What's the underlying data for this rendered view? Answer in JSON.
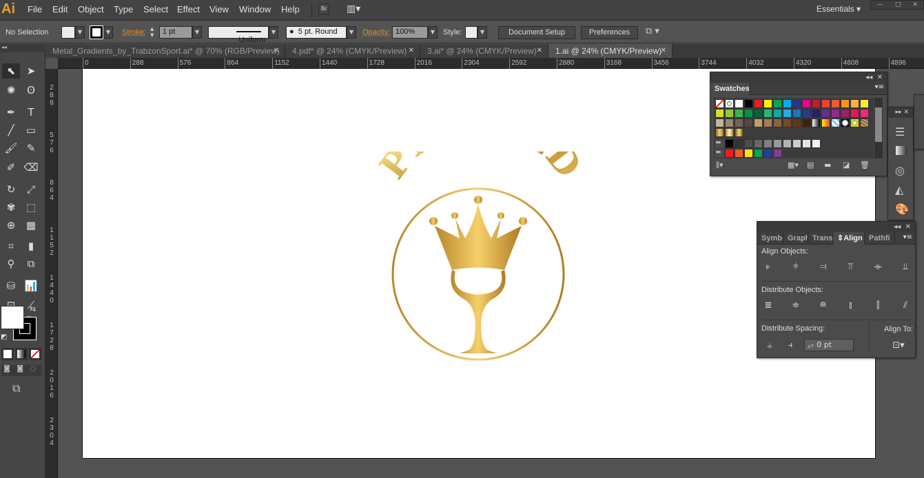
{
  "app": {
    "logo": "Ai",
    "menu": [
      "File",
      "Edit",
      "Object",
      "Type",
      "Select",
      "Effect",
      "View",
      "Window",
      "Help"
    ],
    "bridge": "Br",
    "workspace": "Essentials"
  },
  "control": {
    "selection": "No Selection",
    "stroke_label": "Stroke:",
    "stroke_value": "1 pt",
    "profile": "Uniform",
    "brush": "5 pt. Round",
    "opacity_label": "Opacity:",
    "opacity_value": "100%",
    "style_label": "Style:",
    "document_setup": "Document Setup",
    "preferences": "Preferences"
  },
  "tabs": [
    {
      "label": "Metal_Gradients_by_TrabzonSport.ai* @ 70% (RGB/Preview)",
      "active": false
    },
    {
      "label": "4.pdf* @ 24% (CMYK/Preview)",
      "active": false
    },
    {
      "label": "3.ai* @ 24% (CMYK/Preview)",
      "active": false
    },
    {
      "label": "1.ai @ 24% (CMYK/Preview)",
      "active": true
    }
  ],
  "ruler": {
    "h": [
      "0",
      "288",
      "576",
      "864",
      "1152",
      "1440",
      "1728",
      "2016",
      "2304",
      "2592",
      "2880",
      "3168",
      "3456",
      "3744",
      "4032",
      "4320",
      "4608",
      "4896"
    ],
    "v": [
      "288",
      "576",
      "864",
      "1152",
      "1440",
      "1728",
      "2016",
      "2304"
    ]
  },
  "tools": [
    "selection",
    "direct-selection",
    "magic-wand",
    "lasso",
    "pen",
    "type",
    "line",
    "rectangle",
    "paintbrush",
    "pencil",
    "blob-brush",
    "eraser",
    "rotate",
    "scale",
    "warp",
    "free-transform",
    "shape-builder",
    "perspective-grid",
    "mesh",
    "gradient",
    "eyedropper",
    "blend",
    "symbol-sprayer",
    "column-graph",
    "artboard",
    "slice",
    "hand",
    "zoom"
  ],
  "logo": {
    "text": "PH GOLD"
  },
  "swatches": {
    "title": "Swatches",
    "colors": [
      [
        "none",
        "registration",
        "#ffffff",
        "#000000",
        "#ed1c24",
        "#fff200",
        "#00a651",
        "#00aeef",
        "#2e3192",
        "#ec008c",
        "#be1e2d",
        "#ef4136",
        "#f15a29",
        "#f7941d",
        "#fbb040",
        "#f9ed32"
      ],
      [
        "#d7df23",
        "#8dc63f",
        "#39b54a",
        "#009444",
        "#006838",
        "#2bb673",
        "#13a89e",
        "#27aae1",
        "#1c75bc",
        "#2b3990",
        "#262262",
        "#662d91",
        "#92278f",
        "#9e1f63",
        "#da1c5c",
        "#ee2a7b"
      ],
      [
        "#c2b59b",
        "#998675",
        "#736357",
        "#534741",
        "#c69c6d",
        "#a67c52",
        "#8c6239",
        "#754c24",
        "#603913",
        "#42210b",
        "grad-bw",
        "grad-yo",
        "pattern-blue",
        "pattern-dot",
        "pattern-green",
        "pattern-brown"
      ],
      [
        "grad-gold1",
        "grad-gold2",
        "grad-gold3"
      ],
      [
        "folder",
        "#000000",
        "#333333",
        "#4d4d4d",
        "#666666",
        "#808080",
        "#999999",
        "#b3b3b3",
        "#cccccc",
        "#e6e6e6",
        "#f2f2f2"
      ],
      [
        "folder",
        "#ed1c24",
        "#f15a29",
        "#ffde17",
        "#00a651",
        "#21409a",
        "#7f3f98"
      ]
    ]
  },
  "align": {
    "tabs": [
      "Symbo",
      "Graphi",
      "Transf",
      "Align",
      "Pathfi"
    ],
    "align_objects": "Align Objects:",
    "distribute_objects": "Distribute Objects:",
    "distribute_spacing": "Distribute Spacing:",
    "align_to": "Align To:",
    "spacing_value": "0 pt"
  }
}
